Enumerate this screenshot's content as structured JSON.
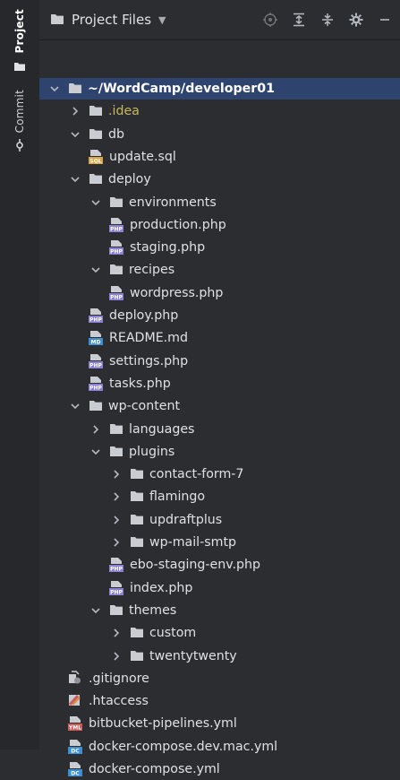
{
  "sidebar_tabs": {
    "project": "Project",
    "commit": "Commit"
  },
  "header": {
    "title": "Project Files"
  },
  "tree": [
    {
      "label": "~/WordCamp/developer01",
      "depth": 0,
      "type": "folder",
      "open": true,
      "selected": true
    },
    {
      "label": ".idea",
      "depth": 1,
      "type": "folder",
      "open": false,
      "style": "idea"
    },
    {
      "label": "db",
      "depth": 1,
      "type": "folder",
      "open": true
    },
    {
      "label": "update.sql",
      "depth": 2,
      "type": "sql"
    },
    {
      "label": "deploy",
      "depth": 1,
      "type": "folder",
      "open": true
    },
    {
      "label": "environments",
      "depth": 2,
      "type": "folder",
      "open": true
    },
    {
      "label": "production.php",
      "depth": 3,
      "type": "php"
    },
    {
      "label": "staging.php",
      "depth": 3,
      "type": "php"
    },
    {
      "label": "recipes",
      "depth": 2,
      "type": "folder",
      "open": true
    },
    {
      "label": "wordpress.php",
      "depth": 3,
      "type": "php"
    },
    {
      "label": "deploy.php",
      "depth": 2,
      "type": "php"
    },
    {
      "label": "README.md",
      "depth": 2,
      "type": "md"
    },
    {
      "label": "settings.php",
      "depth": 2,
      "type": "php"
    },
    {
      "label": "tasks.php",
      "depth": 2,
      "type": "php"
    },
    {
      "label": "wp-content",
      "depth": 1,
      "type": "folder",
      "open": true
    },
    {
      "label": "languages",
      "depth": 2,
      "type": "folder",
      "open": false
    },
    {
      "label": "plugins",
      "depth": 2,
      "type": "folder",
      "open": true
    },
    {
      "label": "contact-form-7",
      "depth": 3,
      "type": "folder",
      "open": false
    },
    {
      "label": "flamingo",
      "depth": 3,
      "type": "folder",
      "open": false
    },
    {
      "label": "updraftplus",
      "depth": 3,
      "type": "folder",
      "open": false
    },
    {
      "label": "wp-mail-smtp",
      "depth": 3,
      "type": "folder",
      "open": false
    },
    {
      "label": "ebo-staging-env.php",
      "depth": 3,
      "type": "php"
    },
    {
      "label": "index.php",
      "depth": 3,
      "type": "php"
    },
    {
      "label": "themes",
      "depth": 2,
      "type": "folder",
      "open": true
    },
    {
      "label": "custom",
      "depth": 3,
      "type": "folder",
      "open": false
    },
    {
      "label": "twentytwenty",
      "depth": 3,
      "type": "folder",
      "open": false
    },
    {
      "label": ".gitignore",
      "depth": 1,
      "type": "gitignore"
    },
    {
      "label": ".htaccess",
      "depth": 1,
      "type": "htaccess"
    },
    {
      "label": "bitbucket-pipelines.yml",
      "depth": 1,
      "type": "yml"
    },
    {
      "label": "docker-compose.dev.mac.yml",
      "depth": 1,
      "type": "dc"
    },
    {
      "label": "docker-compose.yml",
      "depth": 1,
      "type": "dc"
    }
  ],
  "icon_badges": {
    "php": "PHP",
    "sql": "SQL",
    "md": "MD",
    "yml": "YML",
    "dc": "DC"
  },
  "colors": {
    "background": "#2b2d30",
    "selected": "#2e436e",
    "folder": "#c9ccd1",
    "php": "#8b7fd6",
    "sql": "#d9a441",
    "md": "#3d8fd1",
    "yml": "#d05a5a",
    "dc": "#3d8fd1",
    "idea": "#c9b75f"
  }
}
